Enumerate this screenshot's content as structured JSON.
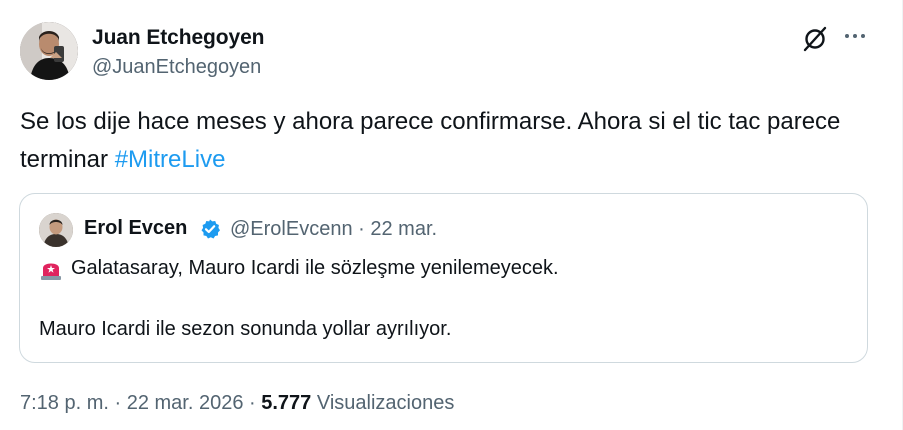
{
  "author": {
    "name": "Juan Etchegoyen",
    "handle": "@JuanEtchegoyen"
  },
  "tweet": {
    "text": "Se los dije hace meses y ahora parece confirmarse. Ahora si el tic tac parece terminar",
    "hashtag": "#MitreLive"
  },
  "quoted": {
    "name": "Erol Evcen",
    "handle_date": "@ErolEvcenn · 22 mar.",
    "line1": "Galatasaray, Mauro Icardi ile sözleşme yenilemeyecek.",
    "line2": "Mauro Icardi ile sezon sonunda yollar ayrılıyor."
  },
  "meta": {
    "time": "7:18 p. m.",
    "sep1": " · ",
    "date": "22 mar. 2026",
    "sep2": " · ",
    "views_count": "5.777",
    "views_label": "Visualizaciones"
  },
  "icons": {
    "header_right": [
      "grok-icon",
      "more-icon"
    ],
    "quote": [
      "verified-badge-icon",
      "siren-emoji-icon"
    ]
  },
  "colors": {
    "link": "#1d9bf0",
    "secondary_text": "#536471",
    "primary_text": "#0f1419",
    "border": "#cfd9de",
    "verified": "#1d9bf0",
    "siren": "#e0245e"
  }
}
